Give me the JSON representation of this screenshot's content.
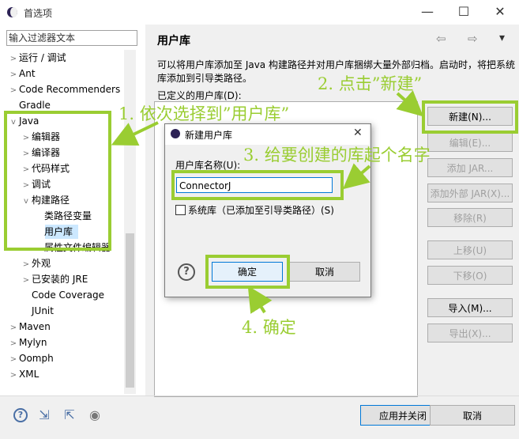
{
  "window": {
    "title": "首选项",
    "minimize": "—",
    "maximize": "☐",
    "close": "✕"
  },
  "filter": {
    "placeholder": "输入过滤器文本"
  },
  "tree": [
    {
      "label": "运行 / 调试",
      "arrow": ">"
    },
    {
      "label": "Ant",
      "arrow": ">"
    },
    {
      "label": "Code Recommenders",
      "arrow": ">"
    },
    {
      "label": "Gradle",
      "arrow": ""
    },
    {
      "label": "Java",
      "arrow": "v"
    },
    {
      "label": "编辑器",
      "arrow": ">"
    },
    {
      "label": "编译器",
      "arrow": ">"
    },
    {
      "label": "代码样式",
      "arrow": ">"
    },
    {
      "label": "调试",
      "arrow": ">"
    },
    {
      "label": "构建路径",
      "arrow": "v"
    },
    {
      "label": "类路径变量",
      "arrow": ""
    },
    {
      "label": "用户库",
      "arrow": ""
    },
    {
      "label": "属性文件编辑器",
      "arrow": ""
    },
    {
      "label": "外观",
      "arrow": ">"
    },
    {
      "label": "已安装的 JRE",
      "arrow": ">"
    },
    {
      "label": "Code Coverage",
      "arrow": ""
    },
    {
      "label": "JUnit",
      "arrow": ""
    },
    {
      "label": "Maven",
      "arrow": ">"
    },
    {
      "label": "Mylyn",
      "arrow": ">"
    },
    {
      "label": "Oomph",
      "arrow": ">"
    },
    {
      "label": "XML",
      "arrow": ">"
    }
  ],
  "page": {
    "title": "用户库",
    "description": "可以将用户库添加至 Java 构建路径并对用户库捆绑大量外部归档。启动时，将把系统库添加到引导类路径。",
    "list_label": "已定义的用户库(D):",
    "nav_back": "⇦",
    "nav_forward": "⇨",
    "menu": "▾"
  },
  "buttons": {
    "new": "新建(N)...",
    "edit": "编辑(E)...",
    "add_jar": "添加 JAR...",
    "add_external_jar": "添加外部 JAR(X)...",
    "remove": "移除(R)",
    "up": "上移(U)",
    "down": "下移(O)",
    "import": "导入(M)...",
    "export": "导出(X)..."
  },
  "bottom": {
    "apply_close": "应用并关闭",
    "cancel": "取消"
  },
  "dialog": {
    "title": "新建用户库",
    "name_label": "用户库名称(U):",
    "name_value": "ConnectorJ",
    "system_lib": "系统库（已添加至引导类路径）(S)",
    "ok": "确定",
    "cancel": "取消",
    "help": "?"
  },
  "annotations": {
    "step1": "1. 依次选择到”用户库”",
    "step2": "2. 点击”新建”",
    "step3": "3. 给要创建的库起个名字",
    "step4": "4. 确定"
  },
  "colors": {
    "highlight": "#9acd32",
    "selection": "#cce8ff"
  }
}
